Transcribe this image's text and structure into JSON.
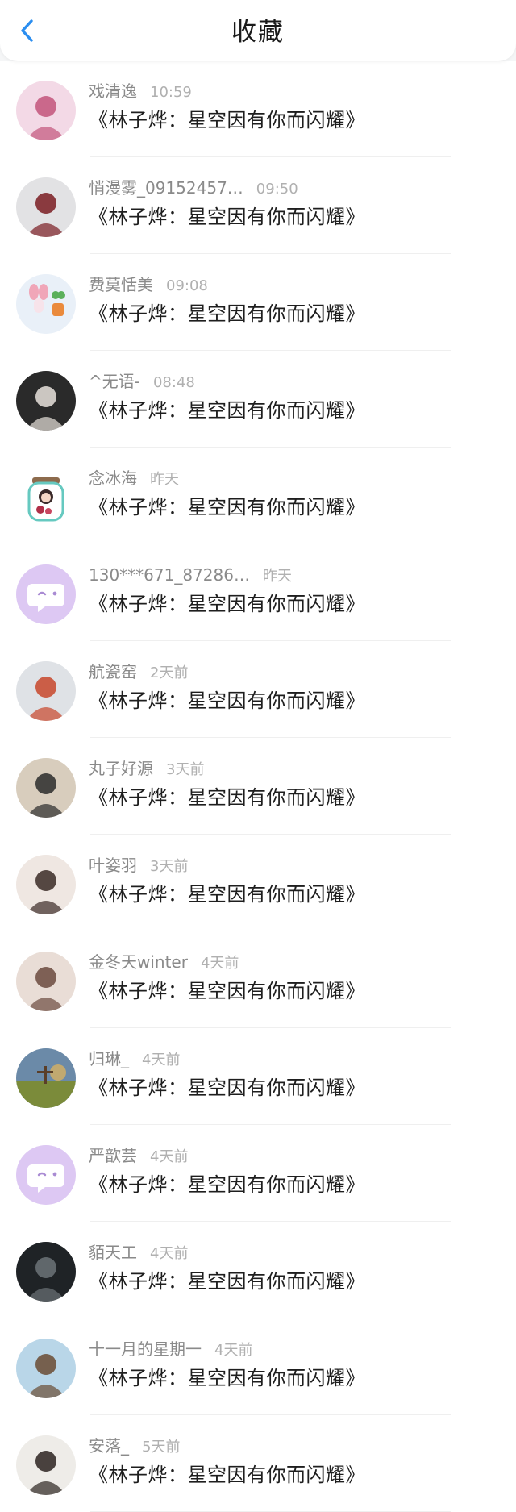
{
  "header": {
    "title": "收藏",
    "back_icon": "chevron-left-icon",
    "accent_color": "#2b8ef0"
  },
  "items": [
    {
      "name": "戏清逸",
      "time": "10:59",
      "title": "《林子烨：星空因有你而闪耀》",
      "avatar_kind": "photo",
      "avatar_colors": [
        "#f3d9e6",
        "#c2547a"
      ]
    },
    {
      "name": "悄漫雾_09152457…",
      "time": "09:50",
      "title": "《林子烨：星空因有你而闪耀》",
      "avatar_kind": "photo",
      "avatar_colors": [
        "#e2e2e4",
        "#7a1c22"
      ]
    },
    {
      "name": "费莫恬美",
      "time": "09:08",
      "title": "《林子烨：星空因有你而闪耀》",
      "avatar_kind": "plant",
      "avatar_colors": [
        "#e9f0f8",
        "#f0a6b8"
      ]
    },
    {
      "name": "^无语-",
      "time": "08:48",
      "title": "《林子烨：星空因有你而闪耀》",
      "avatar_kind": "photo",
      "avatar_colors": [
        "#2a2a2a",
        "#e8e2dc"
      ]
    },
    {
      "name": "念冰海",
      "time": "昨天",
      "title": "《林子烨：星空因有你而闪耀》",
      "avatar_kind": "jar",
      "avatar_colors": [
        "#ffffff",
        "#66c9c0"
      ]
    },
    {
      "name": "130***671_87286…",
      "time": "昨天",
      "title": "《林子烨：星空因有你而闪耀》",
      "avatar_kind": "default",
      "avatar_colors": [
        "#ddc8f3",
        "#ffffff"
      ]
    },
    {
      "name": "航瓷窑",
      "time": "2天前",
      "title": "《林子烨：星空因有你而闪耀》",
      "avatar_kind": "photo",
      "avatar_colors": [
        "#dfe2e6",
        "#c8462a"
      ]
    },
    {
      "name": "丸子好源",
      "time": "3天前",
      "title": "《林子烨：星空因有你而闪耀》",
      "avatar_kind": "photo",
      "avatar_colors": [
        "#d8cdbd",
        "#2b2b2b"
      ]
    },
    {
      "name": "叶姿羽",
      "time": "3天前",
      "title": "《林子烨：星空因有你而闪耀》",
      "avatar_kind": "photo",
      "avatar_colors": [
        "#efe7e2",
        "#3a2a26"
      ]
    },
    {
      "name": "金冬天winter",
      "time": "4天前",
      "title": "《林子烨：星空因有你而闪耀》",
      "avatar_kind": "photo",
      "avatar_colors": [
        "#e9ddd6",
        "#6b4a3e"
      ]
    },
    {
      "name": "归琳_",
      "time": "4天前",
      "title": "《林子烨：星空因有你而闪耀》",
      "avatar_kind": "landscape",
      "avatar_colors": [
        "#6b8aa8",
        "#d7b062"
      ]
    },
    {
      "name": "严歆芸",
      "time": "4天前",
      "title": "《林子烨：星空因有你而闪耀》",
      "avatar_kind": "default",
      "avatar_colors": [
        "#ddc8f3",
        "#ffffff"
      ]
    },
    {
      "name": "貊天工",
      "time": "4天前",
      "title": "《林子烨：星空因有你而闪耀》",
      "avatar_kind": "photo",
      "avatar_colors": [
        "#1f2326",
        "#6c7378"
      ]
    },
    {
      "name": "十一月的星期一",
      "time": "4天前",
      "title": "《林子烨：星空因有你而闪耀》",
      "avatar_kind": "photo",
      "avatar_colors": [
        "#b9d6e8",
        "#6a4b33"
      ]
    },
    {
      "name": "安落_",
      "time": "5天前",
      "title": "《林子烨：星空因有你而闪耀》",
      "avatar_kind": "photo",
      "avatar_colors": [
        "#eeece8",
        "#2b2320"
      ]
    }
  ]
}
